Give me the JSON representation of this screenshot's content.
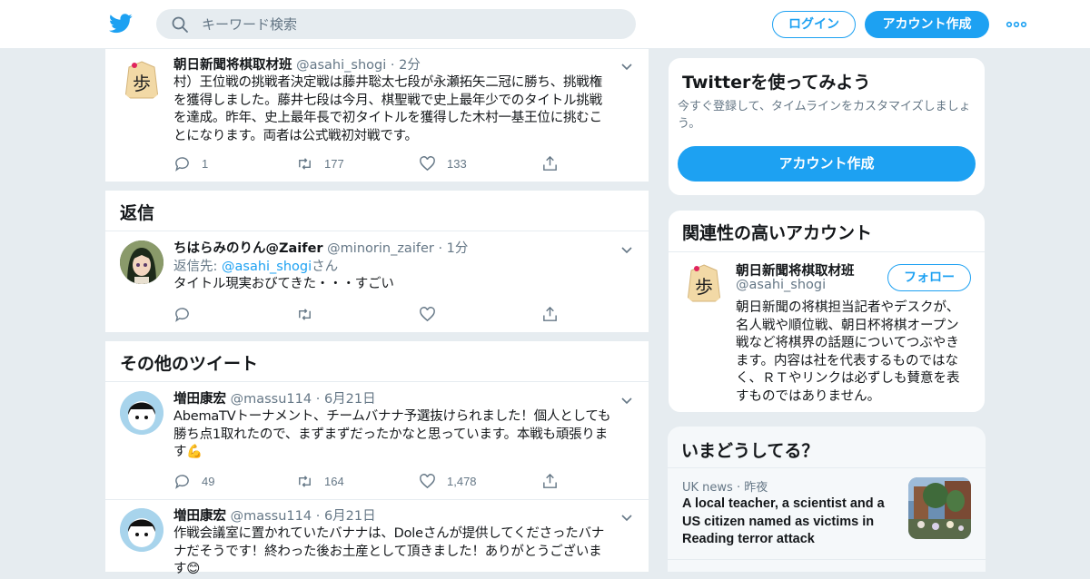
{
  "header": {
    "search_placeholder": "キーワード検索",
    "login_label": "ログイン",
    "signup_label": "アカウント作成",
    "brand_color": "#1da1f2"
  },
  "tweets": [
    {
      "name": "朝日新聞将棋取材班",
      "handle": "@asahi_shogi",
      "dot": "·",
      "time": "2分",
      "text_lines": [
        "村）王位戦の挑戦者決定戦は藤井聡太七段が永瀬拓矢二冠に勝ち、挑戦権",
        "を獲得しました。藤井七段は今月、棋聖戦で史上最年少でのタイトル挑戦",
        "を達成。昨年、史上最年長で初タイトルを獲得した木村一基王位に挑むこ",
        "とになります。両者は公式戦初対戦です。"
      ],
      "reply_count": "1",
      "retweet_count": "177",
      "like_count": "133"
    }
  ],
  "replies_section": {
    "title": "返信",
    "tweet": {
      "name": "ちはらみのりん@Zaifer",
      "handle": "@minorin_zaifer",
      "dot": "·",
      "time": "1分",
      "reply_prefix": "返信先: ",
      "reply_link": "@asahi_shogi",
      "reply_suffix": "さん",
      "text": "タイトル現実おびてきた・・・すごい"
    }
  },
  "more_section": {
    "title": "その他のツイート",
    "tweets": [
      {
        "name": "増田康宏",
        "handle": "@massu114",
        "dot": "·",
        "time": "6月21日",
        "text_lines": [
          "AbemaTVトーナメント、チームバナナ予選抜けられました！個人としても",
          "勝ち点1取れたので、まずまずだったかなと思っています。本戦も頑張りま",
          "す💪"
        ],
        "reply_count": "49",
        "retweet_count": "164",
        "like_count": "1,478"
      },
      {
        "name": "増田康宏",
        "handle": "@massu114",
        "dot": "·",
        "time": "6月21日",
        "text_lines": [
          "作戦会議室に置かれていたバナナは、Doleさんが提供してくださったバナ",
          "ナだそうです！終わった後お土産として頂きました！ありがとうございま",
          "す😊"
        ]
      }
    ]
  },
  "sidebar": {
    "try_card": {
      "title": "Twitterを使ってみよう",
      "subtitle_lines": [
        "今すぐ登録して、タイムラインをカスタマイズしましょ",
        "う。"
      ],
      "button_label": "アカウント作成"
    },
    "related": {
      "title": "関連性の高いアカウント",
      "name": "朝日新聞将棋取材班",
      "handle": "@asahi_shogi",
      "follow_label": "フォロー",
      "bio_lines": [
        "朝日新聞の将棋担当記者やデスクが、",
        "名人戦や順位戦、朝日杯将棋オープン",
        "戦など将棋界の話題についてつぶやき",
        "ます。内容は社を代表するものではな",
        "く、ＲＴやリンクは必ずしも賛意を表",
        "すものではありません。"
      ]
    },
    "trends": {
      "title": "いまどうしてる？",
      "item": {
        "source": "UK news",
        "dot": "·",
        "time": "昨夜",
        "headline_lines": [
          "A local teacher, a scientist and a",
          "US citizen named as victims in",
          "Reading terror attack"
        ]
      }
    }
  }
}
